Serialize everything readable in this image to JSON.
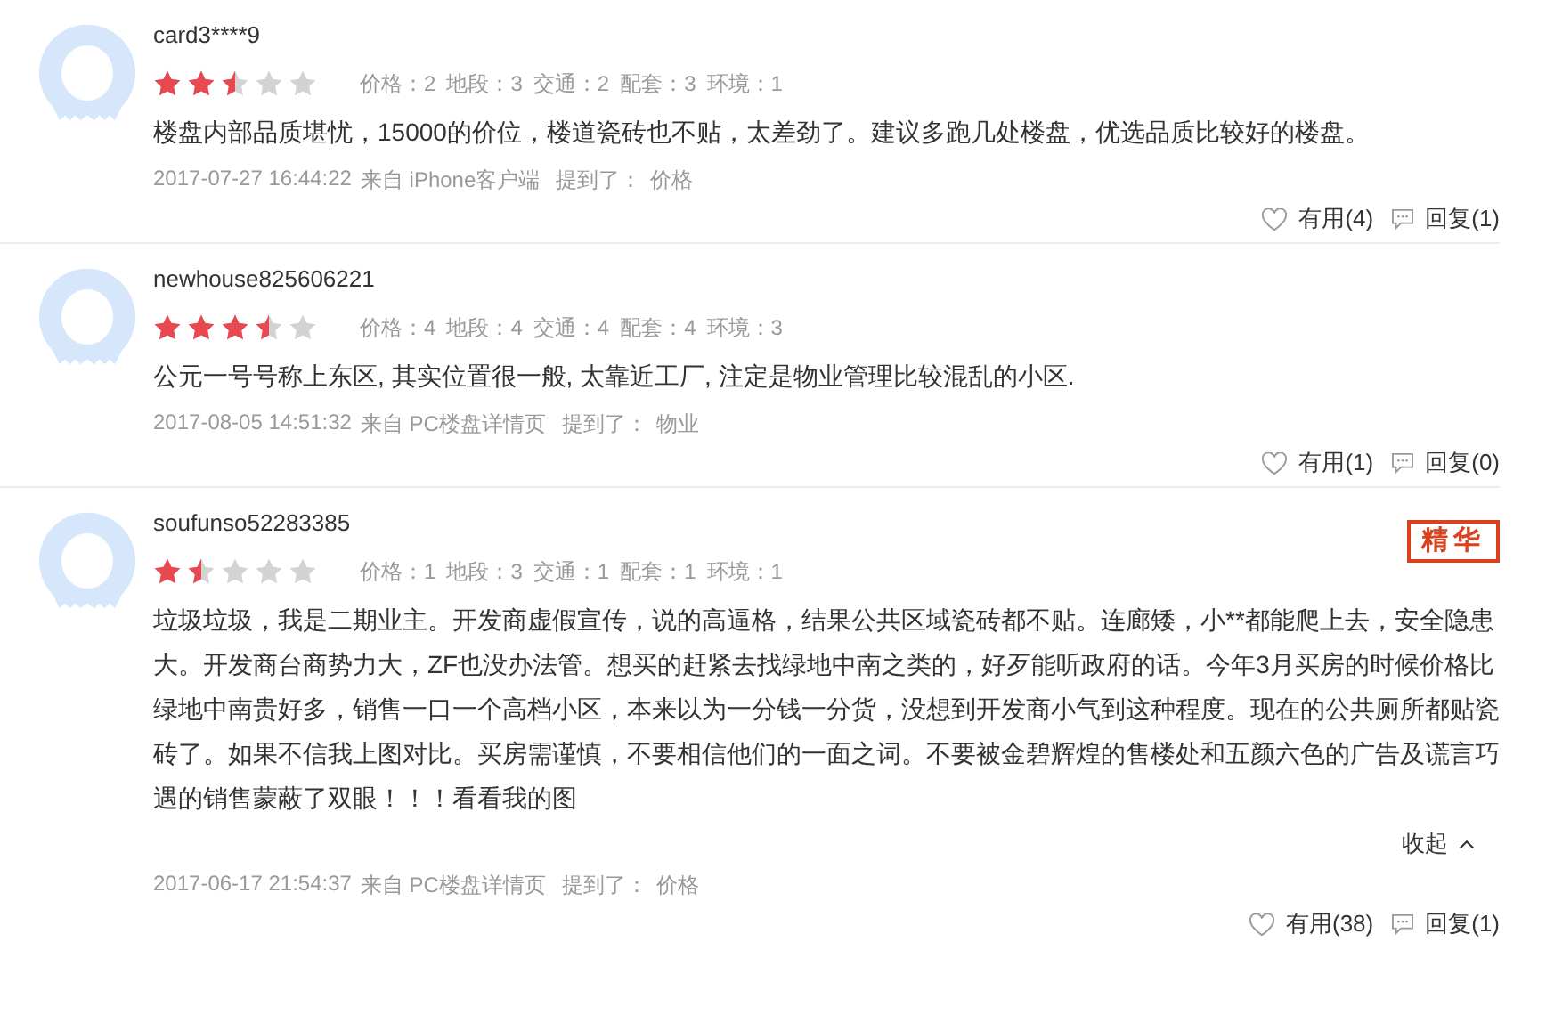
{
  "reviews": [
    {
      "user": "card3****9",
      "stars": 2.5,
      "scores": [
        "价格：2",
        "地段：3",
        "交通：2",
        "配套：3",
        "环境：1"
      ],
      "body": "楼盘内部品质堪忧，15000的价位，楼道瓷砖也不贴，太差劲了。建议多跑几处楼盘，优选品质比较好的楼盘。",
      "time": "2017-07-27 16:44:22",
      "source": "来自 iPhone客户端",
      "mention_label": "提到了：",
      "mention": "价格",
      "useful": "有用(4)",
      "reply": "回复(1)"
    },
    {
      "user": "newhouse825606221",
      "stars": 3.5,
      "scores": [
        "价格：4",
        "地段：4",
        "交通：4",
        "配套：4",
        "环境：3"
      ],
      "body": "公元一号号称上东区, 其实位置很一般, 太靠近工厂, 注定是物业管理比较混乱的小区.",
      "time": "2017-08-05 14:51:32",
      "source": "来自 PC楼盘详情页",
      "mention_label": "提到了：",
      "mention": "物业",
      "useful": "有用(1)",
      "reply": "回复(0)"
    },
    {
      "user": "soufunso52283385",
      "stars": 1.5,
      "badge": "精华",
      "scores": [
        "价格：1",
        "地段：3",
        "交通：1",
        "配套：1",
        "环境：1"
      ],
      "body": "垃圾垃圾，我是二期业主。开发商虚假宣传，说的高逼格，结果公共区域瓷砖都不贴。连廊矮，小**都能爬上去，安全隐患大。开发商台商势力大，ZF也没办法管。想买的赶紧去找绿地中南之类的，好歹能听政府的话。今年3月买房的时候价格比绿地中南贵好多，销售一口一个高档小区，本来以为一分钱一分货，没想到开发商小气到这种程度。现在的公共厕所都贴瓷砖了。如果不信我上图对比。买房需谨慎，不要相信他们的一面之词。不要被金碧辉煌的售楼处和五颜六色的广告及谎言巧遇的销售蒙蔽了双眼！！！看看我的图",
      "collapse": "收起",
      "time": "2017-06-17 21:54:37",
      "source": "来自 PC楼盘详情页",
      "mention_label": "提到了：",
      "mention": "价格",
      "useful": "有用(38)",
      "reply": "回复(1)"
    }
  ]
}
